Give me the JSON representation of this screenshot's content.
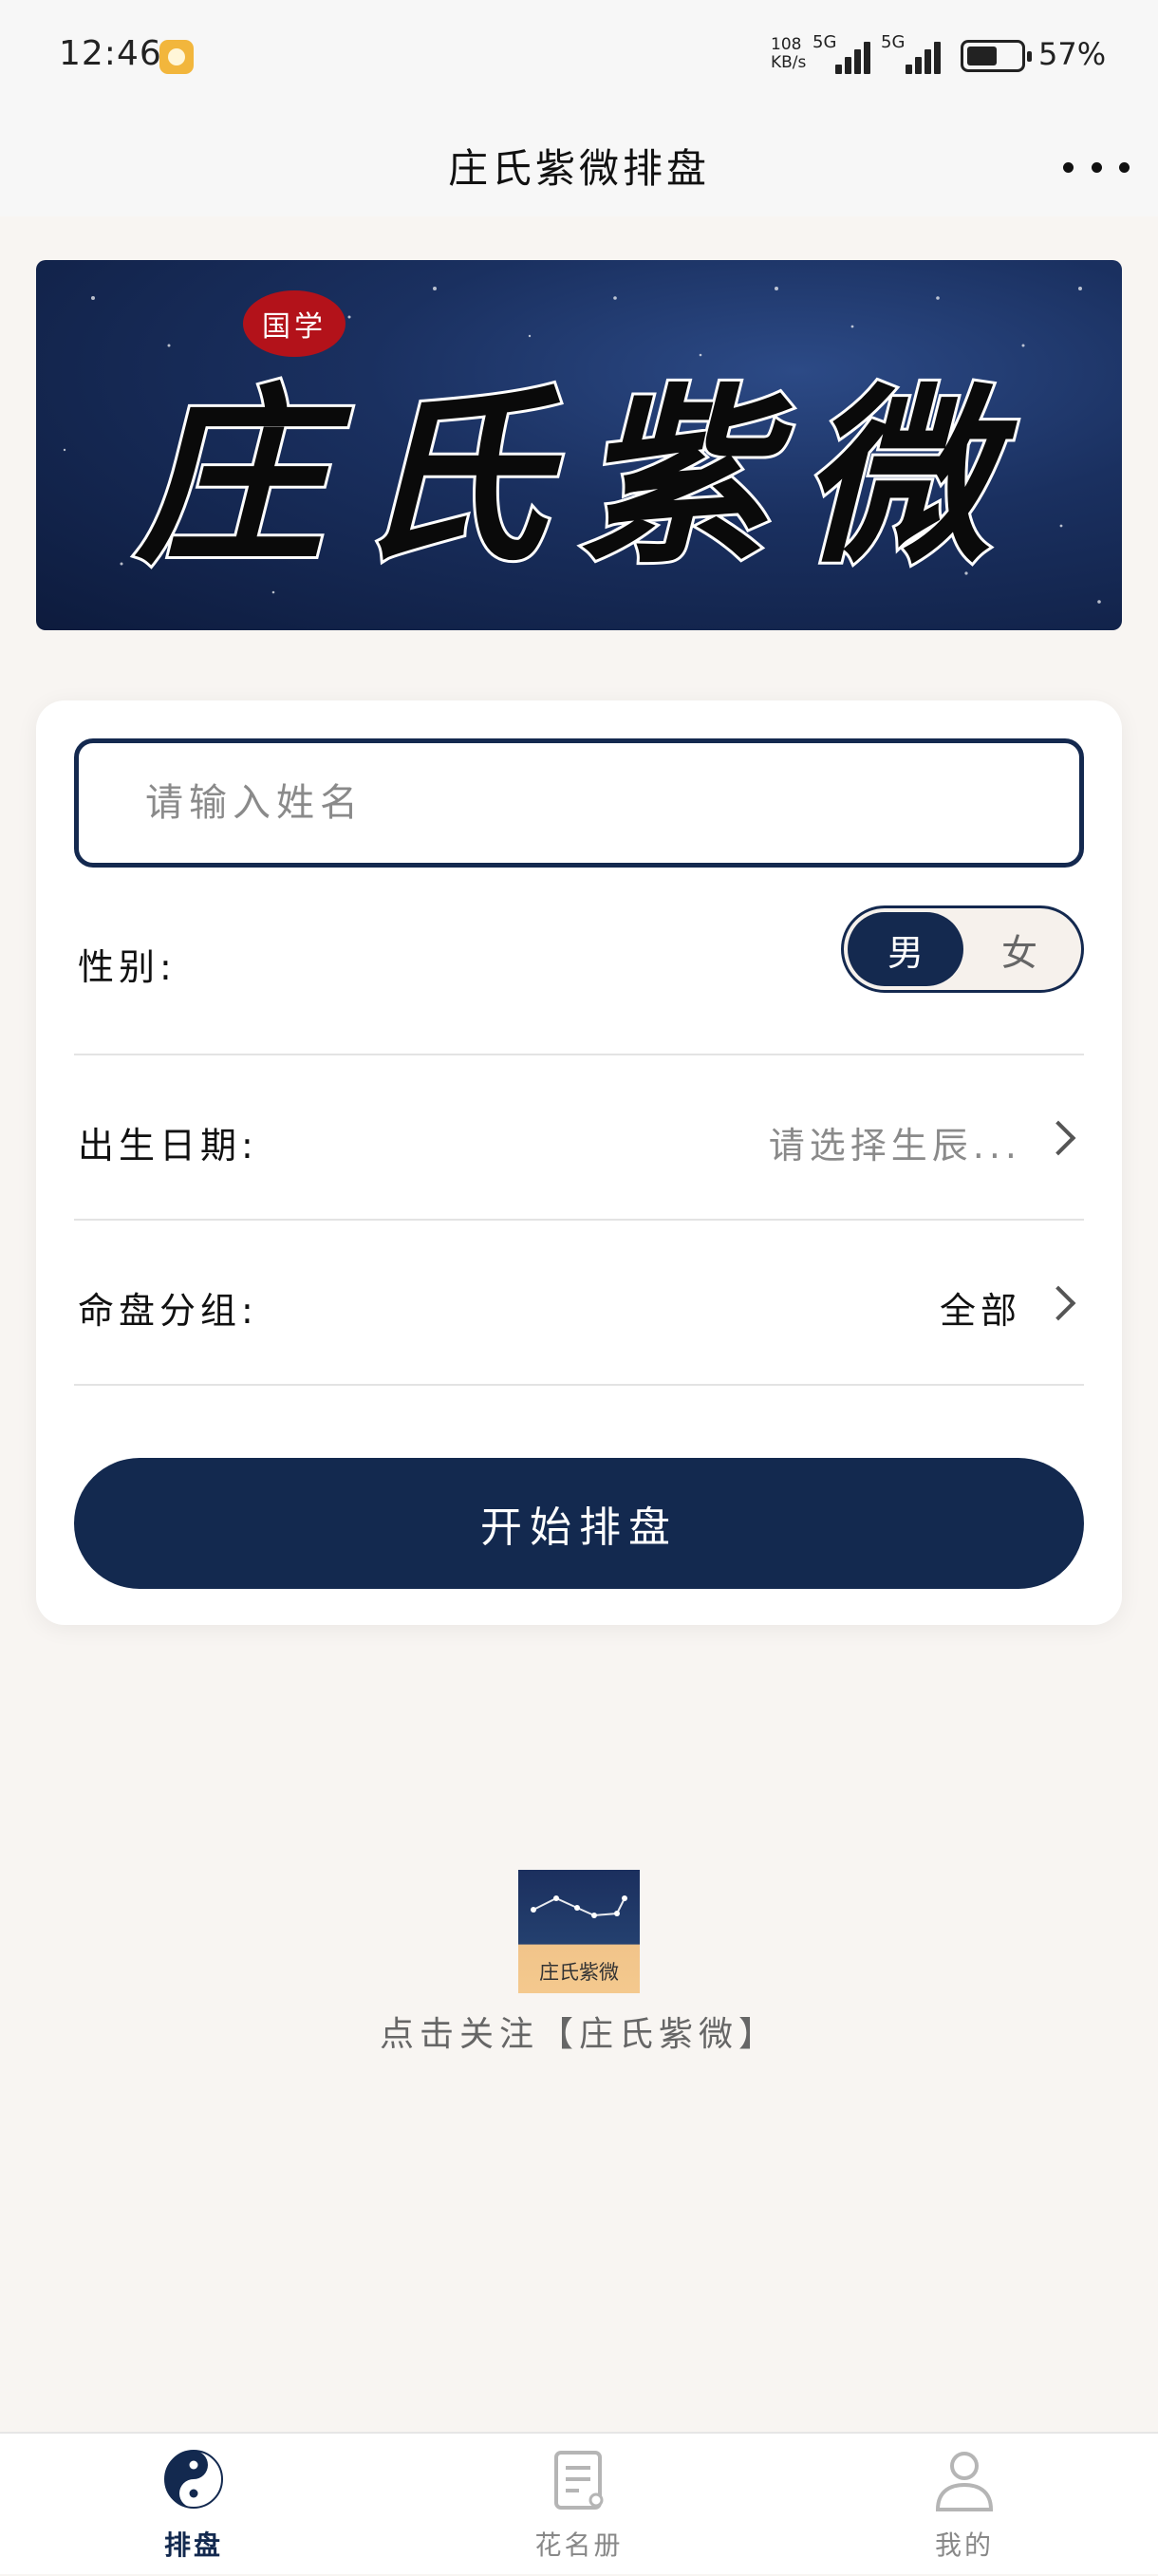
{
  "status_bar": {
    "time": "12:46",
    "net_speed_top": "108",
    "net_speed_bottom": "KB/s",
    "net_type_1": "5G",
    "net_type_2": "5G",
    "battery_level": 0.57,
    "battery_text": "57%"
  },
  "nav": {
    "title": "庄氏紫微排盘",
    "more_icon": "more-dots-icon"
  },
  "banner": {
    "seal_text": "国学",
    "title": "庄氏紫微",
    "background_color": "#1a3060"
  },
  "form": {
    "name_placeholder": "请输入姓名",
    "name_value": "",
    "gender_label": "性别:",
    "gender_male": "男",
    "gender_female": "女",
    "gender_selected": "男",
    "birth_label": "出生日期:",
    "birth_value": "请选择生辰...",
    "group_label": "命盘分组:",
    "group_value": "全部",
    "start_button": "开始排盘",
    "accent_color": "#13294f"
  },
  "follow": {
    "logo_text": "庄氏紫微",
    "text": "点击关注【庄氏紫微】"
  },
  "tabs": [
    {
      "label": "排盘",
      "icon": "yin-yang-icon",
      "active": true
    },
    {
      "label": "花名册",
      "icon": "roster-icon",
      "active": false
    },
    {
      "label": "我的",
      "icon": "user-icon",
      "active": false
    }
  ]
}
